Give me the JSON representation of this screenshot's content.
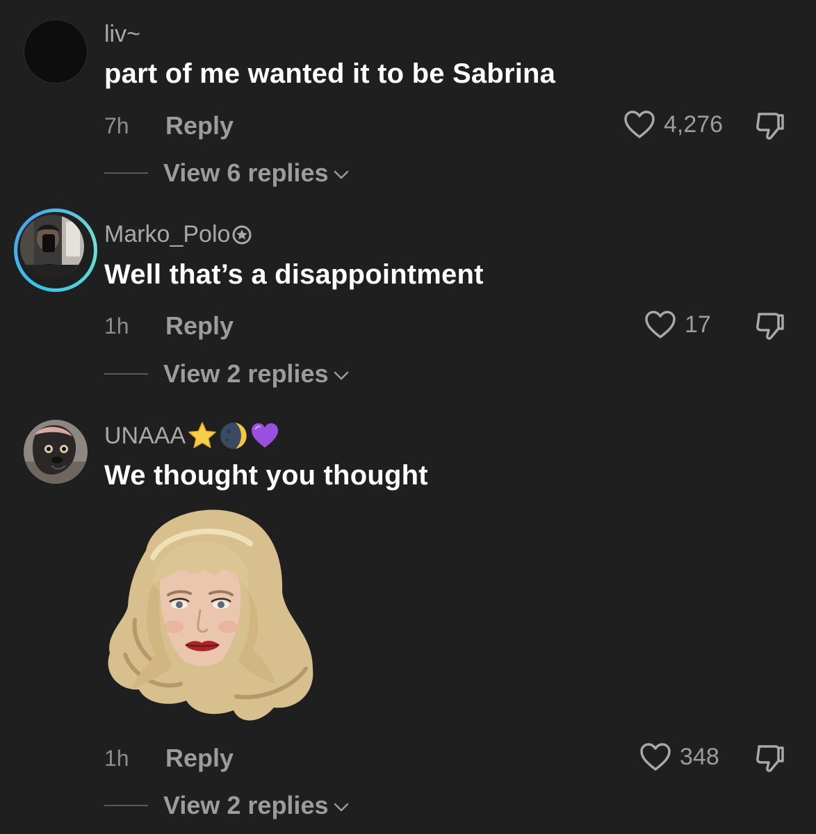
{
  "comments": [
    {
      "username": "liv~",
      "text": "part of me wanted it to be Sabrina",
      "time": "7h",
      "reply_label": "Reply",
      "likes": "4,276",
      "view_replies": "View 6 replies"
    },
    {
      "username": "Marko_Polo",
      "text": "Well that’s a disappointment",
      "time": "1h",
      "reply_label": "Reply",
      "likes": "17",
      "view_replies": "View 2 replies"
    },
    {
      "username": "UNAAA",
      "text": "We thought you thought",
      "time": "1h",
      "reply_label": "Reply",
      "likes": "348",
      "view_replies": "View 2 replies"
    }
  ],
  "icons": {
    "like": "heart-outline-icon",
    "dislike": "thumbs-down-outline-icon",
    "chevron": "chevron-down-icon",
    "badge": "star-badge-icon"
  },
  "colors": {
    "background": "#1f1f1f",
    "text_primary": "#ffffff",
    "text_secondary": "#9c9c9c",
    "story_ring": "#36c7e8"
  }
}
